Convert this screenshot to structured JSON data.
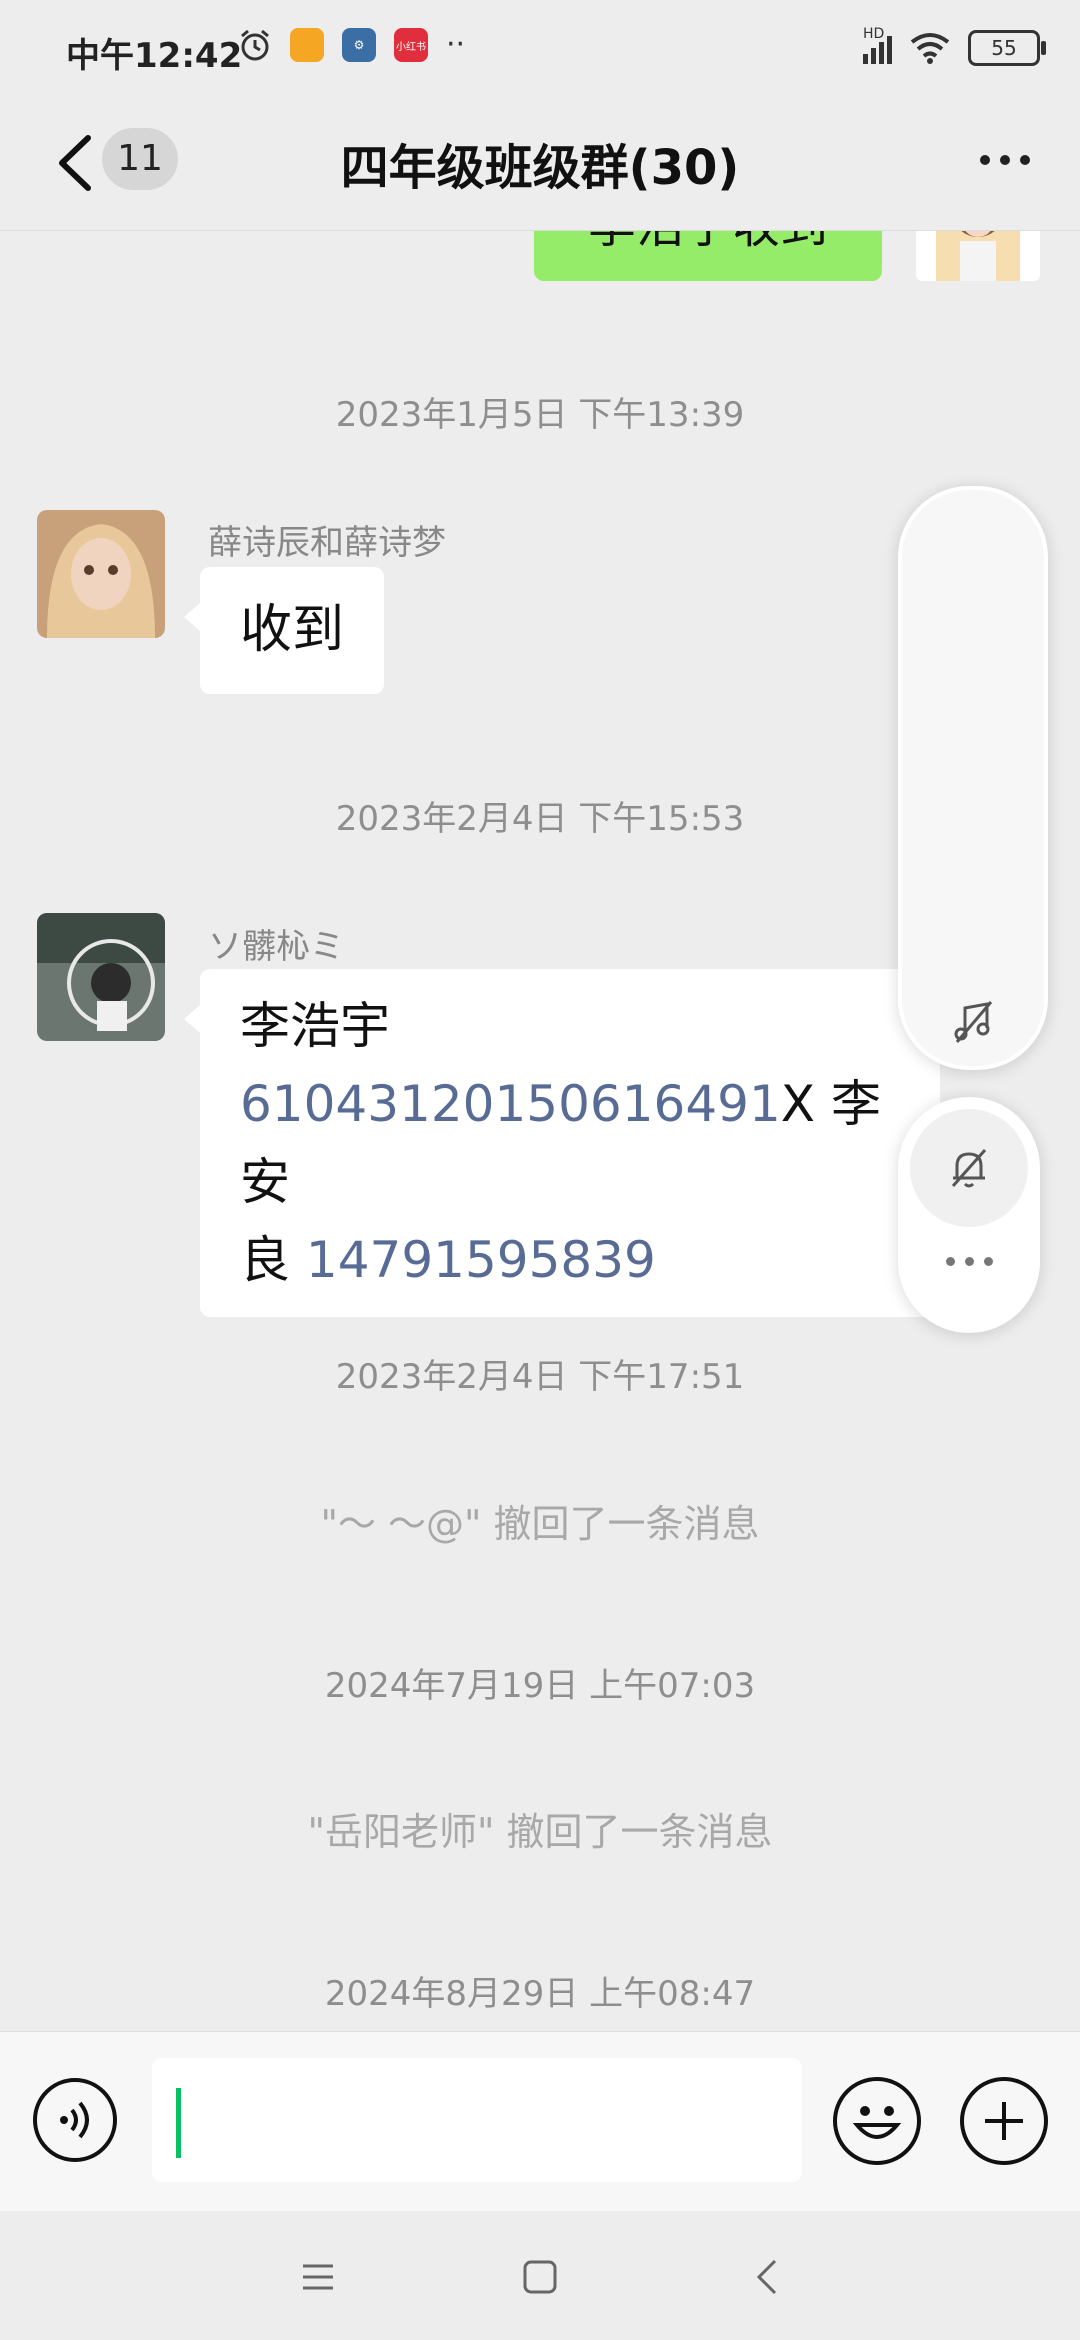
{
  "status_bar": {
    "time": "中午12:42",
    "app_badge_xhs": "小红书",
    "battery": "55",
    "network": "HD"
  },
  "header": {
    "unread_count": "11",
    "title": "四年级班级群(30)"
  },
  "messages": {
    "self_partial_text": "李浩宇收到",
    "ts1": "2023年1月5日 下午13:39",
    "msg1_sender": "薛诗辰和薛诗梦",
    "msg1_text": "收到",
    "ts2": "2023年2月4日 下午15:53",
    "msg2_sender": "ソ髒杺ミ",
    "msg2_line1": "李浩宇",
    "msg2_id": "610431201506164​91",
    "msg2_mid": "X 李安",
    "msg2_line3_prefix": "良 ",
    "msg2_phone": "14791595839",
    "ts3": "2023年2月4日 下午17:51",
    "recall1": "\"～ ～@\" 撤回了一条消息",
    "ts4": "2024年7月19日 上午07:03",
    "recall2": "\"岳阳老师\" 撤回了一条消息",
    "ts5": "2024年8月29日 上午08:47"
  },
  "input": {
    "placeholder": ""
  },
  "colors": {
    "accent": "#07c160",
    "self_bubble": "#95ec69",
    "link": "#576b95"
  },
  "icons": [
    "back-icon",
    "more-icon",
    "music-off-icon",
    "bell-off-icon",
    "voice-icon",
    "emoji-icon",
    "plus-icon",
    "menu-icon",
    "home-icon",
    "back-nav-icon"
  ]
}
